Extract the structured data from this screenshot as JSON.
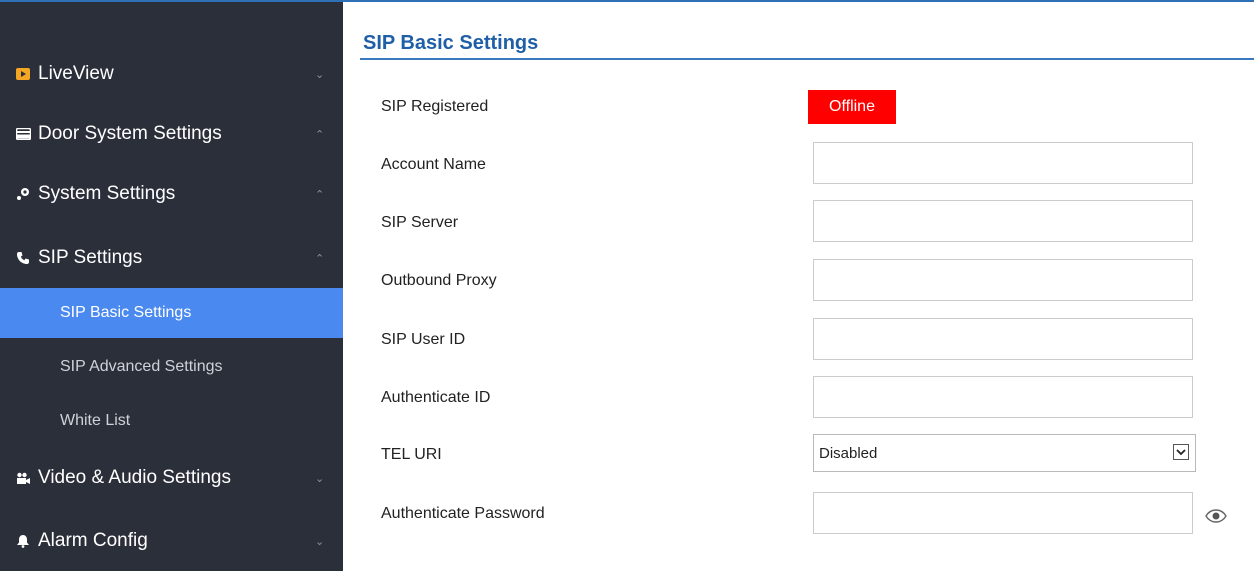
{
  "sidebar": {
    "items": [
      {
        "label": "LiveView",
        "icon": "video-play-icon",
        "chevron": "down"
      },
      {
        "label": "Door System Settings",
        "icon": "card-icon",
        "chevron": "up"
      },
      {
        "label": "System Settings",
        "icon": "wrench-icon",
        "chevron": "up"
      },
      {
        "label": "SIP Settings",
        "icon": "phone-icon",
        "chevron": "up"
      }
    ],
    "sip_sub_items": [
      {
        "label": "SIP Basic Settings",
        "active": true
      },
      {
        "label": "SIP Advanced Settings",
        "active": false
      },
      {
        "label": "White List",
        "active": false
      }
    ],
    "lower_items": [
      {
        "label": "Video & Audio Settings",
        "icon": "camera-icon",
        "chevron": "down"
      },
      {
        "label": "Alarm Config",
        "icon": "bell-icon",
        "chevron": "down"
      }
    ]
  },
  "main": {
    "title": "SIP Basic Settings",
    "fields": {
      "sip_registered": {
        "label": "SIP Registered",
        "status": "Offline"
      },
      "account_name": {
        "label": "Account Name",
        "value": ""
      },
      "sip_server": {
        "label": "SIP Server",
        "value": ""
      },
      "outbound_proxy": {
        "label": "Outbound Proxy",
        "value": ""
      },
      "sip_user_id": {
        "label": "SIP User ID",
        "value": ""
      },
      "authenticate_id": {
        "label": "Authenticate ID",
        "value": ""
      },
      "tel_uri": {
        "label": "TEL URI",
        "value": "Disabled"
      },
      "authenticate_password": {
        "label": "Authenticate Password",
        "value": ""
      }
    }
  },
  "colors": {
    "sidebar_bg": "#2b2f3a",
    "active_item": "#4a8af0",
    "title": "#1f5fa8",
    "offline_badge": "#ff0000",
    "liveview_icon": "#f5a623"
  }
}
